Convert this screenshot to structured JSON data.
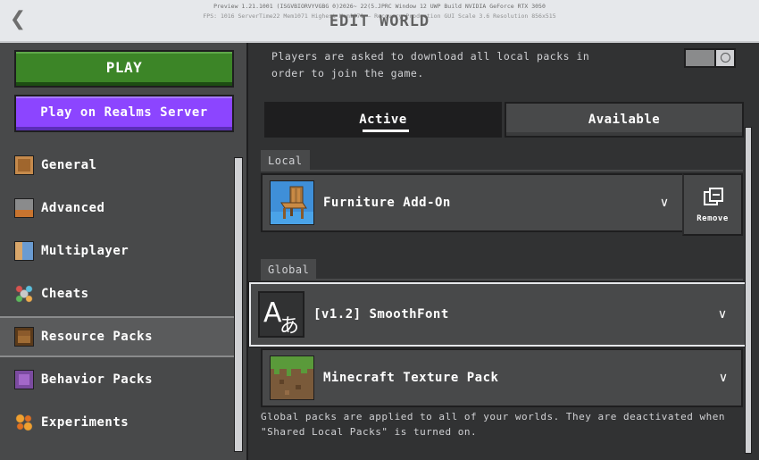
{
  "header": {
    "title": "EDIT WORLD",
    "debug_line_1": "Preview 1.21.1001 (ISGVBIORVYVGBG 0)2026~ 22(5.JPRC Window 12 UWP Build NVIDIA GeForce RTX 3050",
    "debug_line_2": "FPS: 1016 ServerTime22 Mem1071 Highest Mem1071 — Recovery Production GUI Scale 3.6 Resolution 856x515"
  },
  "sidebar": {
    "play_label": "PLAY",
    "realms_label": "Play on Realms Server",
    "items": [
      {
        "label": "General",
        "icon": "general-icon",
        "active": false
      },
      {
        "label": "Advanced",
        "icon": "advanced-icon",
        "active": false
      },
      {
        "label": "Multiplayer",
        "icon": "multiplayer-icon",
        "active": false
      },
      {
        "label": "Cheats",
        "icon": "cheats-icon",
        "active": false
      },
      {
        "label": "Resource Packs",
        "icon": "resource-packs-icon",
        "active": true
      },
      {
        "label": "Behavior Packs",
        "icon": "behavior-packs-icon",
        "active": false
      },
      {
        "label": "Experiments",
        "icon": "experiments-icon",
        "active": false
      }
    ]
  },
  "main": {
    "description": "Players are asked to download all local packs in order to join the game.",
    "tabs": [
      {
        "label": "Active",
        "active": true
      },
      {
        "label": "Available",
        "active": false
      }
    ],
    "local_label": "Local",
    "global_label": "Global",
    "local_packs": [
      {
        "name": "Furniture Add-On",
        "icon": "chair-icon"
      }
    ],
    "remove_label": "Remove",
    "global_packs": [
      {
        "name": "[v1.2] SmoothFont",
        "icon": "font-glyph-icon"
      },
      {
        "name": "Minecraft Texture Pack",
        "icon": "grass-block-icon"
      }
    ],
    "footer_note": "Global packs are applied to all of your worlds. They are deactivated when \"Shared Local Packs\" is turned on."
  },
  "colors": {
    "background": "#313233",
    "panel": "#48494a",
    "play_green": "#3c8527",
    "realms_purple": "#8c45ff",
    "border": "#1e1e1f"
  }
}
